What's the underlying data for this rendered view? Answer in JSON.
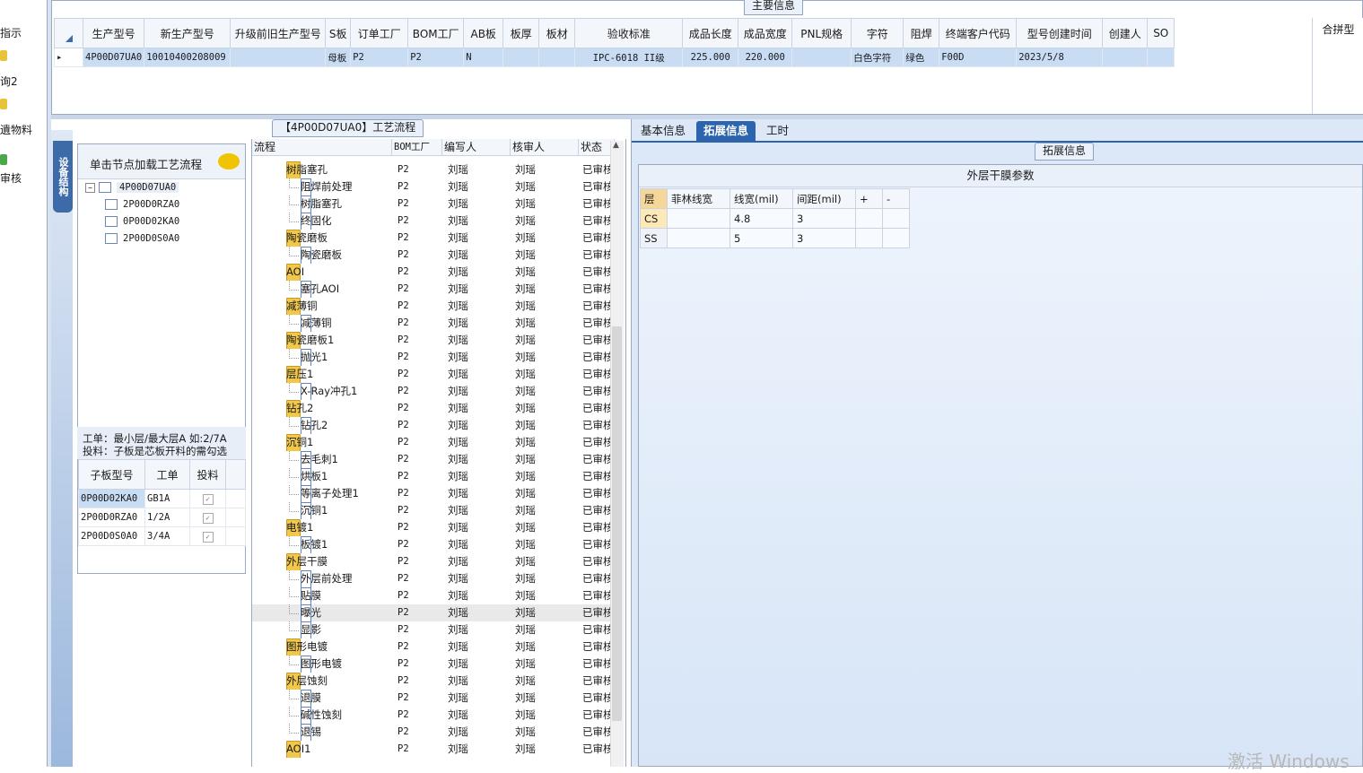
{
  "left_nav": {
    "items": [
      "指示",
      "询2",
      "遺物料",
      "审核"
    ]
  },
  "main_info": {
    "title": "主要信息",
    "columns": [
      "生产型号",
      "新生产型号",
      "升级前旧生产型号",
      "S板",
      "订单工厂",
      "BOM工厂",
      "AB板",
      "板厚",
      "板材",
      "验收标准",
      "成品长度",
      "成品宽度",
      "PNL规格",
      "字符",
      "阻焊",
      "终端客户代码",
      "型号创建时间",
      "创建人",
      "SO"
    ],
    "rows": [
      [
        "4P00D07UA0",
        "10010400208009",
        "",
        "母板",
        "P2",
        "P2",
        "N",
        "",
        "",
        "IPC-6018 II级",
        "225.000",
        "220.000",
        "",
        "白色字符",
        "绿色",
        "F00D",
        "2023/5/8",
        "",
        ""
      ]
    ],
    "right_header": "合拼型"
  },
  "process_flow": {
    "title": "【4P00D07UA0】工艺流程",
    "columns": [
      "流程",
      "BOM工厂",
      "编写人",
      "核审人",
      "状态"
    ],
    "rows": [
      {
        "name": "树脂塞孔",
        "type": "folder",
        "bom": "P2",
        "writer": "刘瑶",
        "reviewer": "刘瑶",
        "status": "已审核"
      },
      {
        "name": "阻焊前处理",
        "type": "doc",
        "bom": "P2",
        "writer": "刘瑶",
        "reviewer": "刘瑶",
        "status": "已审核"
      },
      {
        "name": "树脂塞孔",
        "type": "doc",
        "bom": "P2",
        "writer": "刘瑶",
        "reviewer": "刘瑶",
        "status": "已审核"
      },
      {
        "name": "终固化",
        "type": "doc",
        "bom": "P2",
        "writer": "刘瑶",
        "reviewer": "刘瑶",
        "status": "已审核"
      },
      {
        "name": "陶瓷磨板",
        "type": "folder",
        "bom": "P2",
        "writer": "刘瑶",
        "reviewer": "刘瑶",
        "status": "已审核"
      },
      {
        "name": "陶瓷磨板",
        "type": "doc",
        "bom": "P2",
        "writer": "刘瑶",
        "reviewer": "刘瑶",
        "status": "已审核"
      },
      {
        "name": "AOI",
        "type": "folder",
        "bom": "P2",
        "writer": "刘瑶",
        "reviewer": "刘瑶",
        "status": "已审核"
      },
      {
        "name": "塞孔AOI",
        "type": "doc",
        "bom": "P2",
        "writer": "刘瑶",
        "reviewer": "刘瑶",
        "status": "已审核"
      },
      {
        "name": "减薄铜",
        "type": "folder",
        "bom": "P2",
        "writer": "刘瑶",
        "reviewer": "刘瑶",
        "status": "已审核"
      },
      {
        "name": "减薄铜",
        "type": "doc",
        "bom": "P2",
        "writer": "刘瑶",
        "reviewer": "刘瑶",
        "status": "已审核"
      },
      {
        "name": "陶瓷磨板1",
        "type": "folder",
        "bom": "P2",
        "writer": "刘瑶",
        "reviewer": "刘瑶",
        "status": "已审核"
      },
      {
        "name": "抛光1",
        "type": "doc",
        "bom": "P2",
        "writer": "刘瑶",
        "reviewer": "刘瑶",
        "status": "已审核"
      },
      {
        "name": "层压1",
        "type": "folder",
        "bom": "P2",
        "writer": "刘瑶",
        "reviewer": "刘瑶",
        "status": "已审核"
      },
      {
        "name": "X-Ray冲孔1",
        "type": "doc",
        "bom": "P2",
        "writer": "刘瑶",
        "reviewer": "刘瑶",
        "status": "已审核"
      },
      {
        "name": "钻孔2",
        "type": "folder",
        "bom": "P2",
        "writer": "刘瑶",
        "reviewer": "刘瑶",
        "status": "已审核"
      },
      {
        "name": "钻孔2",
        "type": "doc",
        "bom": "P2",
        "writer": "刘瑶",
        "reviewer": "刘瑶",
        "status": "已审核"
      },
      {
        "name": "沉铜1",
        "type": "folder",
        "bom": "P2",
        "writer": "刘瑶",
        "reviewer": "刘瑶",
        "status": "已审核"
      },
      {
        "name": "去毛刺1",
        "type": "doc",
        "bom": "P2",
        "writer": "刘瑶",
        "reviewer": "刘瑶",
        "status": "已审核"
      },
      {
        "name": "烘板1",
        "type": "doc",
        "bom": "P2",
        "writer": "刘瑶",
        "reviewer": "刘瑶",
        "status": "已审核"
      },
      {
        "name": "等离子处理1",
        "type": "doc",
        "bom": "P2",
        "writer": "刘瑶",
        "reviewer": "刘瑶",
        "status": "已审核"
      },
      {
        "name": "沉铜1",
        "type": "doc",
        "bom": "P2",
        "writer": "刘瑶",
        "reviewer": "刘瑶",
        "status": "已审核"
      },
      {
        "name": "电镀1",
        "type": "folder",
        "bom": "P2",
        "writer": "刘瑶",
        "reviewer": "刘瑶",
        "status": "已审核"
      },
      {
        "name": "板镀1",
        "type": "doc",
        "bom": "P2",
        "writer": "刘瑶",
        "reviewer": "刘瑶",
        "status": "已审核"
      },
      {
        "name": "外层干膜",
        "type": "folder",
        "bom": "P2",
        "writer": "刘瑶",
        "reviewer": "刘瑶",
        "status": "已审核"
      },
      {
        "name": "外层前处理",
        "type": "doc",
        "bom": "P2",
        "writer": "刘瑶",
        "reviewer": "刘瑶",
        "status": "已审核"
      },
      {
        "name": "贴膜",
        "type": "doc",
        "bom": "P2",
        "writer": "刘瑶",
        "reviewer": "刘瑶",
        "status": "已审核"
      },
      {
        "name": "曝光",
        "type": "doc",
        "bom": "P2",
        "writer": "刘瑶",
        "reviewer": "刘瑶",
        "status": "已审核",
        "selected": true
      },
      {
        "name": "显影",
        "type": "doc",
        "bom": "P2",
        "writer": "刘瑶",
        "reviewer": "刘瑶",
        "status": "已审核"
      },
      {
        "name": "图形电镀",
        "type": "folder",
        "bom": "P2",
        "writer": "刘瑶",
        "reviewer": "刘瑶",
        "status": "已审核"
      },
      {
        "name": "图形电镀",
        "type": "doc",
        "bom": "P2",
        "writer": "刘瑶",
        "reviewer": "刘瑶",
        "status": "已审核"
      },
      {
        "name": "外层蚀刻",
        "type": "folder",
        "bom": "P2",
        "writer": "刘瑶",
        "reviewer": "刘瑶",
        "status": "已审核"
      },
      {
        "name": "退膜",
        "type": "doc",
        "bom": "P2",
        "writer": "刘瑶",
        "reviewer": "刘瑶",
        "status": "已审核"
      },
      {
        "name": "碱性蚀刻",
        "type": "doc",
        "bom": "P2",
        "writer": "刘瑶",
        "reviewer": "刘瑶",
        "status": "已审核"
      },
      {
        "name": "退锡",
        "type": "doc",
        "bom": "P2",
        "writer": "刘瑶",
        "reviewer": "刘瑶",
        "status": "已审核"
      },
      {
        "name": "AOI1",
        "type": "folder",
        "bom": "P2",
        "writer": "刘瑶",
        "reviewer": "刘瑶",
        "status": "已审核"
      }
    ]
  },
  "structure": {
    "side_tab": "设备结构",
    "hint": "单击节点加载工艺流程",
    "root": "4P00D07UA0",
    "children": [
      "2P00D0RZA0",
      "0P00D02KA0",
      "2P00D0S0A0"
    ],
    "note_line1": "工单：最小层/最大层A 如:2/7A",
    "note_line2": "投料：子板是芯板开料的需勾选",
    "sub_table": {
      "columns": [
        "子板型号",
        "工单",
        "投料"
      ],
      "rows": [
        [
          "0P00D02KA0",
          "GB1A",
          true
        ],
        [
          "2P00D0RZA0",
          "1/2A",
          true
        ],
        [
          "2P00D0S0A0",
          "3/4A",
          true
        ]
      ]
    }
  },
  "right": {
    "tabs": [
      "基本信息",
      "拓展信息",
      "工时"
    ],
    "active_tab": "拓展信息",
    "ext_title": "拓展信息",
    "param_title": "外层干膜参数",
    "param_columns": [
      "层",
      "菲林线宽",
      "线宽(mil)",
      "间距(mil)",
      "+",
      "-"
    ],
    "param_rows": [
      [
        "CS",
        "",
        "4.8",
        "3",
        "",
        ""
      ],
      [
        "SS",
        "",
        "5",
        "3",
        "",
        ""
      ]
    ]
  },
  "watermark": "激活 Windows",
  "colors": {
    "accent": "#2c64ad",
    "selected_row": "#c8dcf4",
    "folder": "#f2c84b"
  }
}
